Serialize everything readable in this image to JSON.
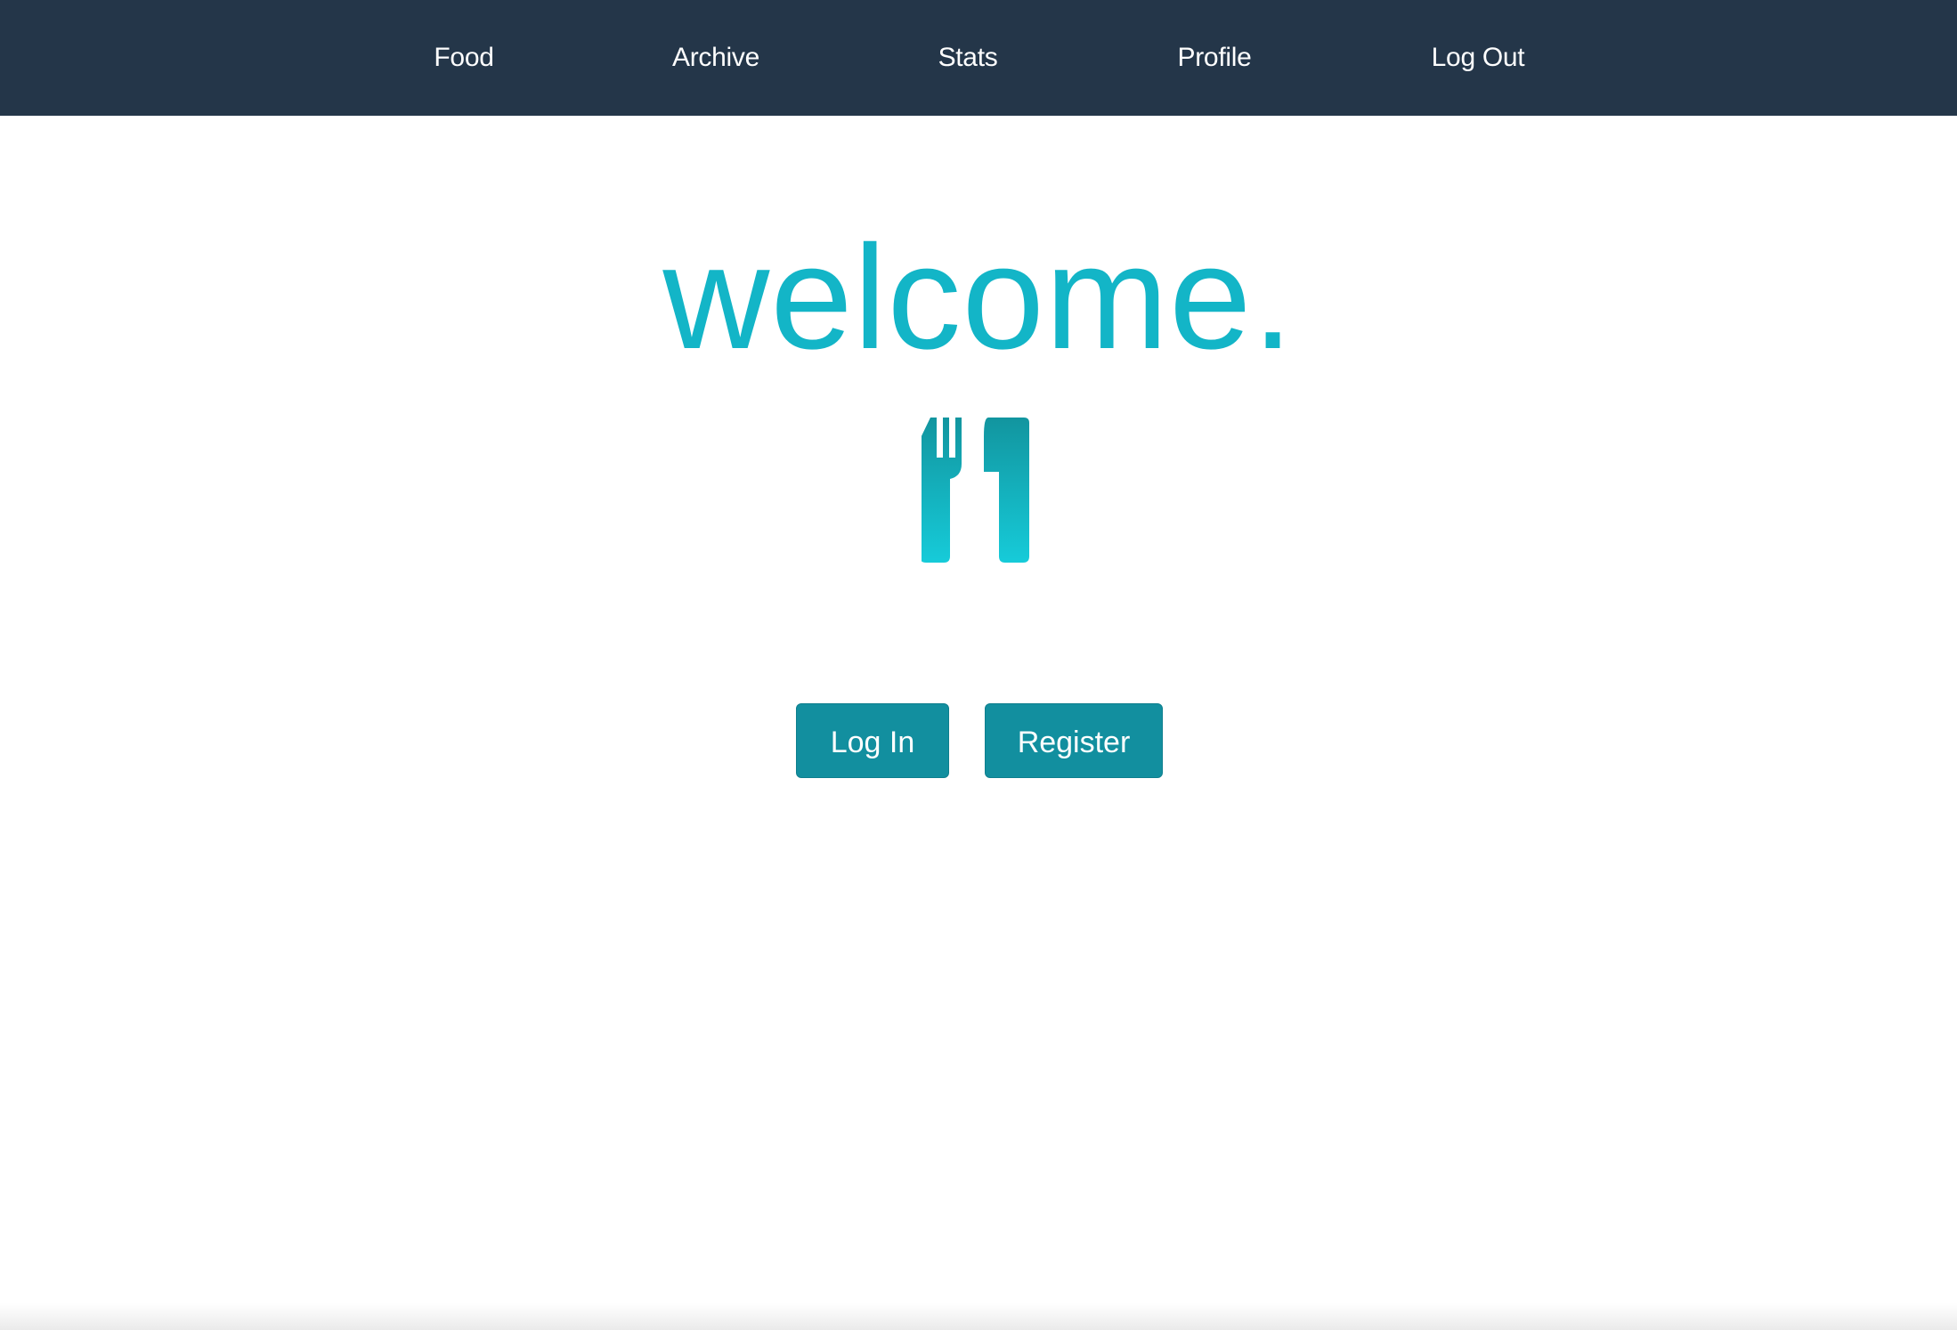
{
  "navbar": {
    "background": "#243649",
    "items": [
      {
        "label": "Food"
      },
      {
        "label": "Archive"
      },
      {
        "label": "Stats"
      },
      {
        "label": "Profile"
      },
      {
        "label": "Log Out"
      }
    ]
  },
  "main": {
    "heading": "welcome.",
    "heading_color": "#13b5c7",
    "icon": "fork-knife-icon",
    "buttons": {
      "login_label": "Log In",
      "register_label": "Register",
      "color": "#128f9f"
    }
  }
}
